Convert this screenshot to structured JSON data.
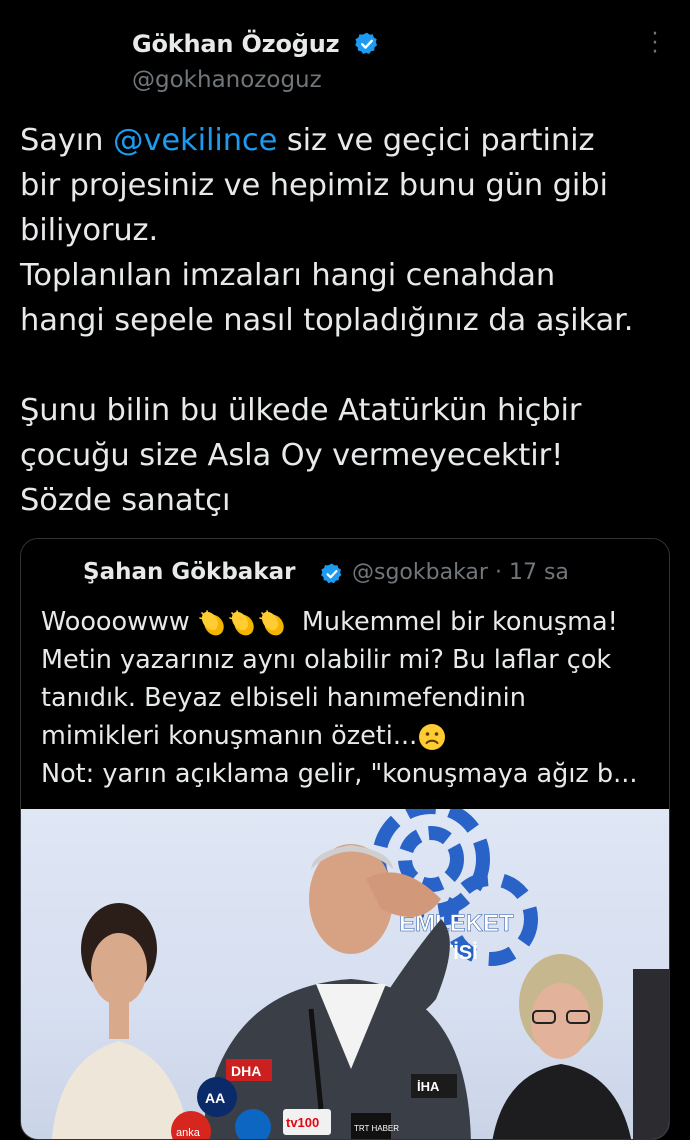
{
  "tweet": {
    "author_name": "Gökhan Özoğuz",
    "handle": "@gokhanozoguz",
    "text_lines": [
      {
        "before": "Sayın ",
        "mention": "@vekilince",
        "after": " siz ve geçici partiniz"
      },
      {
        "text": "bir projesiniz ve hepimiz bunu gün gibi"
      },
      {
        "text": "biliyoruz."
      },
      {
        "text": "Toplanılan imzaları hangi cenahdan"
      },
      {
        "text": "hangi sepele nasıl topladığınız da aşikar."
      },
      {
        "text": ""
      },
      {
        "text": "Şunu bilin bu ülkede Atatürkün hiçbir"
      },
      {
        "text": "çocuğu size Asla Oy vermeyecektir!"
      },
      {
        "text": "Sözde sanatçı"
      }
    ]
  },
  "quote": {
    "author_name": "Şahan Gökbakar",
    "handle": "@sgokbakar",
    "separator": "·",
    "time": "17 sa",
    "line1_before": "Woooowww ",
    "line1_after": " Mukemmel bir konuşma!",
    "line2": "Metin yazarınız aynı olabilir mi? Bu laflar çok",
    "line3": "tanıdık. Beyaz elbiseli hanımefendinin",
    "line4": "mimikleri konuşmanın özeti...",
    "line5": "Not: yarın açıklama gelir, \"konuşmaya ağız b...",
    "media": {
      "backdrop_text_1": "EMLEKET",
      "backdrop_text_2": "TİSİ",
      "mic_labels": [
        "DHA",
        "AA",
        "anka",
        "tv100",
        "TRT HABER",
        "İHA"
      ]
    }
  },
  "icons": [
    "verified-badge-icon",
    "more-options-icon",
    "clapping-hands-icon",
    "slightly-frowning-face-icon"
  ],
  "colors": {
    "background": "#000000",
    "text": "#e7e9ea",
    "secondary": "#71767b",
    "mention": "#1d9bf0",
    "border": "#2f3336",
    "verified": "#1d9bf0"
  }
}
